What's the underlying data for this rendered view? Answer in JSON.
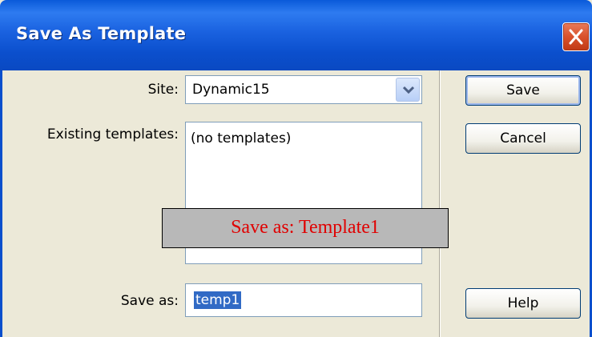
{
  "window": {
    "title": "Save As Template"
  },
  "form": {
    "site_label": "Site:",
    "site_value": "Dynamic15",
    "existing_label": "Existing templates:",
    "existing_items": [
      "(no templates)"
    ],
    "saveas_label": "Save as:",
    "saveas_value": "temp1"
  },
  "buttons": {
    "save": "Save",
    "cancel": "Cancel",
    "help": "Help"
  },
  "overlay": {
    "text": "Save as: Template1"
  },
  "colors": {
    "titlebar": "#0a5ad9",
    "close": "#d9512b",
    "overlay_text": "#e00000",
    "selection": "#316ac5"
  },
  "icons": {
    "close": "close-icon",
    "dropdown": "chevron-down-icon"
  }
}
